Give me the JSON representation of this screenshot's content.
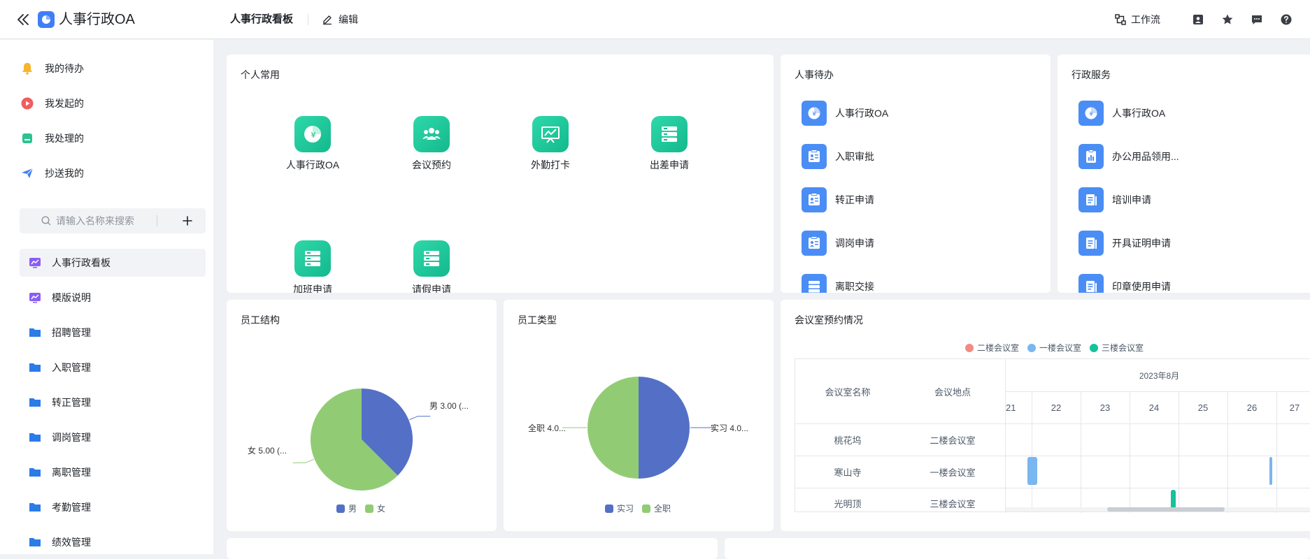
{
  "header": {
    "app_title": "人事行政OA",
    "page_title": "人事行政看板",
    "edit_label": "编辑",
    "workflow_label": "工作流",
    "icons": [
      "chevrons-left-icon",
      "app-logo-icon",
      "edit-icon",
      "workflow-icon",
      "contact-icon",
      "star-icon",
      "chat-icon",
      "help-icon"
    ]
  },
  "sidebar": {
    "quick": [
      {
        "label": "我的待办",
        "icon": "bell-icon",
        "color": "#f7b52c"
      },
      {
        "label": "我发起的",
        "icon": "play-icon",
        "color": "#f05d5d"
      },
      {
        "label": "我处理的",
        "icon": "inbox-icon",
        "color": "#2bc48f"
      },
      {
        "label": "抄送我的",
        "icon": "send-icon",
        "color": "#3f7ef7"
      }
    ],
    "search_placeholder": "请输入名称来搜索",
    "nav": [
      {
        "label": "人事行政看板",
        "icon": "dashboard-icon",
        "active": true
      },
      {
        "label": "模版说明",
        "icon": "dashboard-icon",
        "active": false
      },
      {
        "label": "招聘管理",
        "icon": "folder-icon",
        "active": false
      },
      {
        "label": "入职管理",
        "icon": "folder-icon",
        "active": false
      },
      {
        "label": "转正管理",
        "icon": "folder-icon",
        "active": false
      },
      {
        "label": "调岗管理",
        "icon": "folder-icon",
        "active": false
      },
      {
        "label": "离职管理",
        "icon": "folder-icon",
        "active": false
      },
      {
        "label": "考勤管理",
        "icon": "folder-icon",
        "active": false
      },
      {
        "label": "绩效管理",
        "icon": "folder-icon",
        "active": false
      }
    ]
  },
  "personal": {
    "title": "个人常用",
    "apps": [
      {
        "label": "人事行政OA",
        "icon": "pie-yen-icon"
      },
      {
        "label": "会议预约",
        "icon": "people-icon"
      },
      {
        "label": "外勤打卡",
        "icon": "presentation-icon"
      },
      {
        "label": "出差申请",
        "icon": "server-icon"
      },
      {
        "label": "加班申请",
        "icon": "server-icon"
      },
      {
        "label": "请假申请",
        "icon": "server-icon"
      }
    ]
  },
  "hr_todo": {
    "title": "人事待办",
    "items": [
      {
        "label": "人事行政OA",
        "icon": "pie-yen-icon"
      },
      {
        "label": "入职审批",
        "icon": "id-card-icon"
      },
      {
        "label": "转正申请",
        "icon": "id-card-icon"
      },
      {
        "label": "调岗申请",
        "icon": "id-card-icon"
      },
      {
        "label": "离职交接",
        "icon": "server-icon"
      }
    ]
  },
  "admin_service": {
    "title": "行政服务",
    "items": [
      {
        "label": "人事行政OA",
        "icon": "pie-yen-icon"
      },
      {
        "label": "办公用品领用...",
        "icon": "clipboard-chart-icon"
      },
      {
        "label": "培训申请",
        "icon": "document-icon"
      },
      {
        "label": "开具证明申请",
        "icon": "document-icon"
      },
      {
        "label": "印章使用申请",
        "icon": "document-icon"
      }
    ]
  },
  "employee_structure": {
    "title": "员工结构",
    "slice_labels": [
      "男 3.00  (...",
      "女 5.00  (..."
    ],
    "legend": [
      "男",
      "女"
    ]
  },
  "employee_type": {
    "title": "员工类型",
    "slice_labels": [
      "实习 4.0...",
      "全职 4.0..."
    ],
    "legend": [
      "实习",
      "全职"
    ]
  },
  "meeting": {
    "title": "会议室预约情况",
    "legend": [
      "二楼会议室",
      "一楼会议室",
      "三楼会议室"
    ],
    "legend_colors": [
      "#f08c85",
      "#7ab6ef",
      "#14c29b"
    ],
    "col_name": "会议室名称",
    "col_location": "会议地点",
    "month": "2023年8月",
    "days": [
      "21",
      "22",
      "23",
      "24",
      "25",
      "26",
      "27"
    ],
    "rows": [
      {
        "name": "桃花坞",
        "location": "二楼会议室"
      },
      {
        "name": "寒山寺",
        "location": "一楼会议室"
      },
      {
        "name": "光明顶",
        "location": "三楼会议室"
      }
    ]
  },
  "chart_data": [
    {
      "type": "pie",
      "title": "员工结构",
      "categories": [
        "男",
        "女"
      ],
      "values": [
        3,
        5
      ],
      "colors": [
        "#5470c6",
        "#91cc75"
      ],
      "legend": "bottom"
    },
    {
      "type": "pie",
      "title": "员工类型",
      "categories": [
        "实习",
        "全职"
      ],
      "values": [
        4,
        4
      ],
      "colors": [
        "#5470c6",
        "#91cc75"
      ],
      "legend": "bottom"
    }
  ]
}
